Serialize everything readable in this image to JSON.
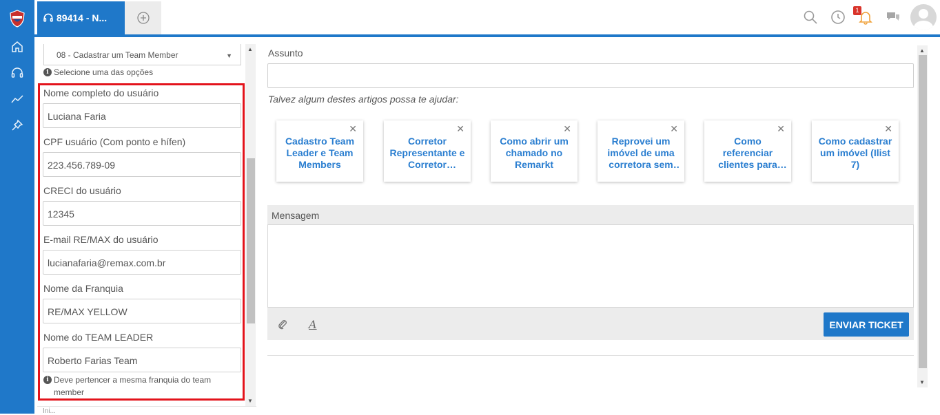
{
  "tabs": {
    "active_label": "89414 - N...",
    "add_label": "+"
  },
  "header": {
    "notification_count": "1"
  },
  "left_panel": {
    "select_value": "08 - Cadastrar um Team Member",
    "select_hint": "Selecione uma das opções",
    "fields": [
      {
        "label": "Nome completo do usuário",
        "value": "Luciana Faria"
      },
      {
        "label": "CPF usuário (Com ponto e hífen)",
        "value": "223.456.789-09"
      },
      {
        "label": "CRECI do usuário",
        "value": "12345"
      },
      {
        "label": "E-mail RE/MAX do usuário",
        "value": "lucianafaria@remax.com.br"
      },
      {
        "label": "Nome da Franquia",
        "value": "RE/MAX YELLOW"
      },
      {
        "label": "Nome do TEAM LEADER",
        "value": "Roberto Farias Team"
      }
    ],
    "team_leader_hint": "Deve pertencer a mesma franquia do team member",
    "footer_text": "Ini..."
  },
  "main": {
    "subject_label": "Assunto",
    "subject_value": "",
    "suggestion_text": "Talvez algum destes artigos possa te ajudar:",
    "articles": [
      "Cadastro Team Leader e Team Members",
      "Corretor Representante e Corretor Associado",
      "Como abrir um chamado no Remarkt",
      "Reprovei um imóvel de uma corretora sem querer",
      "Como referenciar clientes para outros corretores",
      "Como cadastrar um imóvel (Ilist 7)"
    ],
    "message_label": "Mensagem",
    "send_button": "ENVIAR TICKET"
  },
  "colors": {
    "brand_blue": "#1f78c9",
    "article_link": "#2a7ed0",
    "highlight_red": "#e3131b",
    "badge_red": "#d9342b"
  }
}
